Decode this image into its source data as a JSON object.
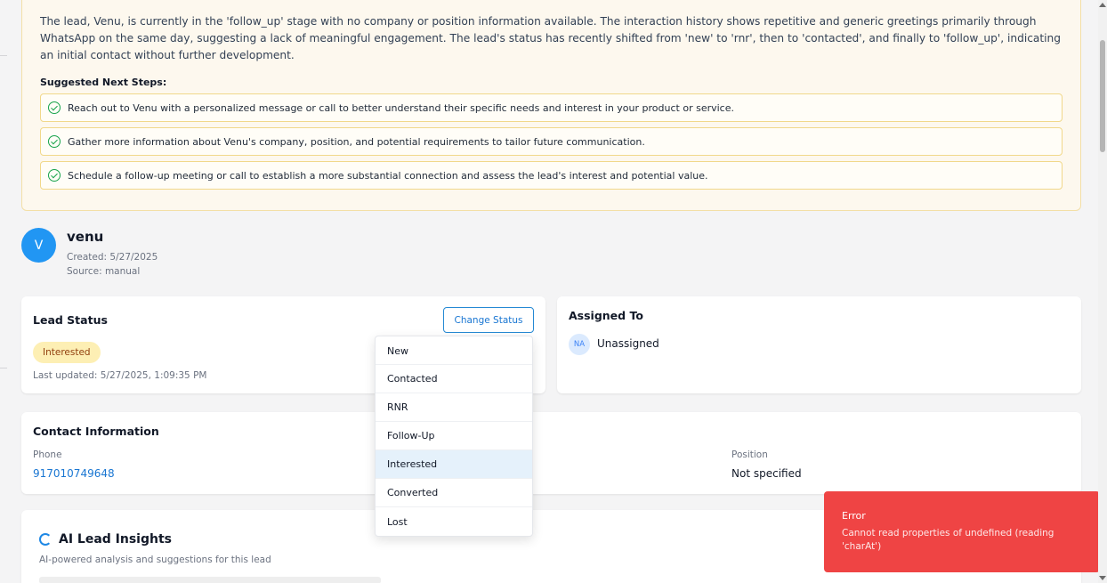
{
  "summary": {
    "text": "The lead, Venu, is currently in the 'follow_up' stage with no company or position information available. The interaction history shows repetitive and generic greetings primarily through WhatsApp on the same day, suggesting a lack of meaningful engagement. The lead's status has recently shifted from 'new' to 'rnr', then to 'contacted', and finally to 'follow_up', indicating an initial contact without further development.",
    "next_steps_title": "Suggested Next Steps:",
    "steps": [
      "Reach out to Venu with a personalized message or call to better understand their specific needs and interest in your product or service.",
      "Gather more information about Venu's company, position, and potential requirements to tailor future communication.",
      "Schedule a follow-up meeting or call to establish a more substantial connection and assess the lead's interest and potential value."
    ]
  },
  "lead": {
    "initial": "V",
    "name": "venu",
    "created": "Created: 5/27/2025",
    "source": "Source: manual"
  },
  "status_card": {
    "title": "Lead Status",
    "change_button": "Change Status",
    "badge": "Interested",
    "last_updated": "Last updated: 5/27/2025, 1:09:35 PM"
  },
  "status_menu": {
    "options": [
      "New",
      "Contacted",
      "RNR",
      "Follow-Up",
      "Interested",
      "Converted",
      "Lost"
    ],
    "selected": "Interested"
  },
  "assigned_card": {
    "title": "Assigned To",
    "avatar": "NA",
    "name": "Unassigned"
  },
  "contact_card": {
    "title": "Contact Information",
    "phone_label": "Phone",
    "phone_value": "917010749648",
    "position_label": "Position",
    "position_value": "Not specified"
  },
  "insights_card": {
    "title": "AI Lead Insights",
    "subtitle": "AI-powered analysis and suggestions for this lead"
  },
  "toast": {
    "title": "Error",
    "message": "Cannot read properties of undefined (reading 'charAt')"
  },
  "colors": {
    "accent": "#1976d2",
    "avatar": "#2196f3",
    "error": "#ef4444",
    "badge_bg": "#fdefb4",
    "summary_bg": "#fdf8ee"
  }
}
